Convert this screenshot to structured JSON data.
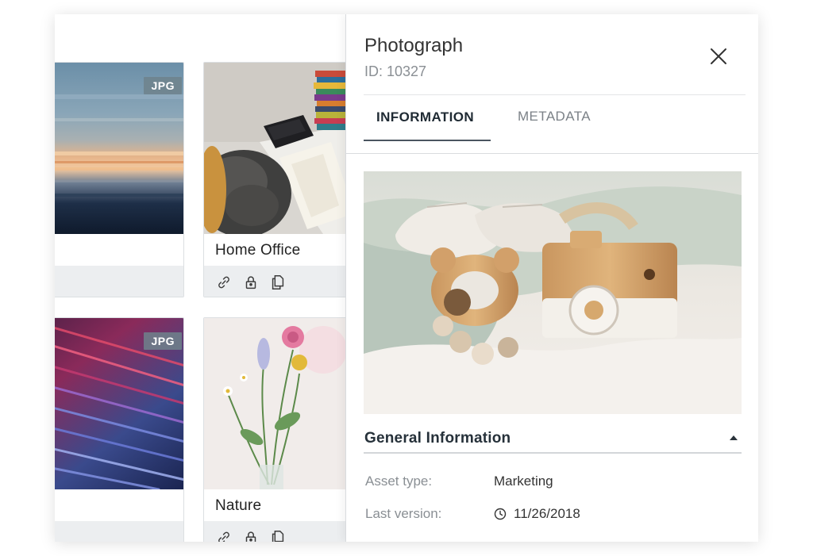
{
  "grid": {
    "cards": [
      {
        "title": "",
        "badge": "JPG"
      },
      {
        "title": "Home Office",
        "badge": ""
      },
      {
        "title": "",
        "badge": "JPG"
      },
      {
        "title": "Nature",
        "badge": ""
      }
    ],
    "card_icons": [
      "link-icon",
      "lock-icon",
      "copy-icon"
    ]
  },
  "panel": {
    "title": "Photograph",
    "id_label": "ID: 10327",
    "tabs": [
      {
        "label": "INFORMATION",
        "active": true
      },
      {
        "label": "METADATA",
        "active": false
      }
    ],
    "section": {
      "title": "General Information",
      "expanded": true,
      "rows": [
        {
          "label": "Asset type:",
          "value": "Marketing"
        },
        {
          "label": "Last version:",
          "value": "11/26/2018",
          "icon": "clock-icon"
        }
      ]
    }
  },
  "colors": {
    "badge": "#6e828c",
    "active_tab_underline": "#4a5560",
    "card_footer": "#eceef0"
  }
}
